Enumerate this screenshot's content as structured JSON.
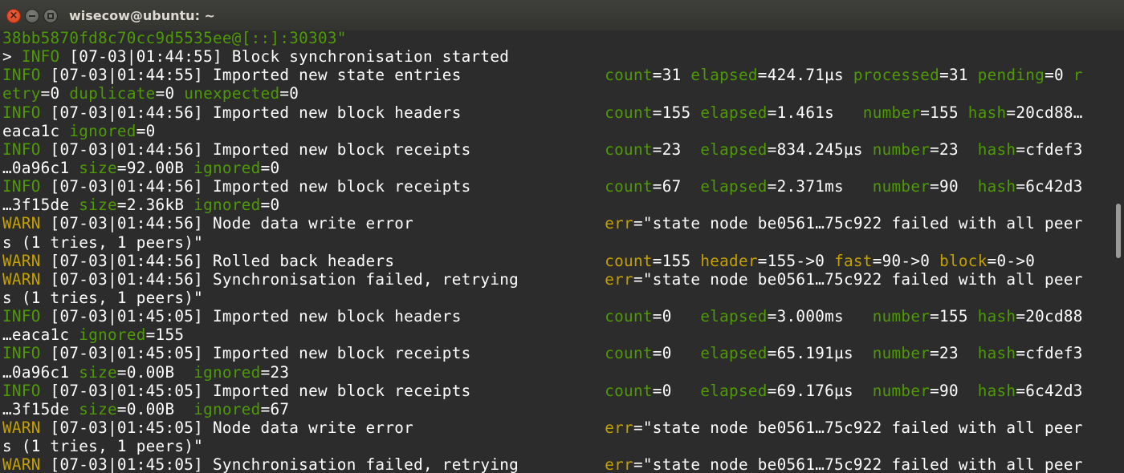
{
  "window": {
    "title": "wisecow@ubuntu: ~",
    "buttons": {
      "close": "×",
      "minimize": "",
      "maximize": ""
    }
  },
  "terminal": {
    "colors": {
      "background": "#2c2c2c",
      "text": "#ffffff",
      "info": "#4e9a06",
      "warn": "#c4a000"
    },
    "lines": [
      [
        {
          "t": "38bb5870fd8c70cc9d5535ee@[::]:30303\"",
          "c": "g"
        }
      ],
      [
        {
          "t": "> ",
          "c": "w"
        },
        {
          "t": "INFO",
          "c": "g"
        },
        {
          "t": " [07-03|01:44:55] Block synchronisation started",
          "c": "w"
        }
      ],
      [
        {
          "t": "INFO",
          "c": "g"
        },
        {
          "t": " [07-03|01:44:55] Imported new state entries               ",
          "c": "w"
        },
        {
          "t": "count",
          "c": "g"
        },
        {
          "t": "=31 ",
          "c": "w"
        },
        {
          "t": "elapsed",
          "c": "g"
        },
        {
          "t": "=424.71µs ",
          "c": "w"
        },
        {
          "t": "processed",
          "c": "g"
        },
        {
          "t": "=31 ",
          "c": "w"
        },
        {
          "t": "pending",
          "c": "g"
        },
        {
          "t": "=0 ",
          "c": "w"
        },
        {
          "t": "r",
          "c": "g"
        }
      ],
      [
        {
          "t": "etry",
          "c": "g"
        },
        {
          "t": "=0 ",
          "c": "w"
        },
        {
          "t": "duplicate",
          "c": "g"
        },
        {
          "t": "=0 ",
          "c": "w"
        },
        {
          "t": "unexpected",
          "c": "g"
        },
        {
          "t": "=0",
          "c": "w"
        }
      ],
      [
        {
          "t": "INFO",
          "c": "g"
        },
        {
          "t": " [07-03|01:44:56] Imported new block headers               ",
          "c": "w"
        },
        {
          "t": "count",
          "c": "g"
        },
        {
          "t": "=155 ",
          "c": "w"
        },
        {
          "t": "elapsed",
          "c": "g"
        },
        {
          "t": "=1.461s   ",
          "c": "w"
        },
        {
          "t": "number",
          "c": "g"
        },
        {
          "t": "=155 ",
          "c": "w"
        },
        {
          "t": "hash",
          "c": "g"
        },
        {
          "t": "=20cd88…",
          "c": "w"
        }
      ],
      [
        {
          "t": "eaca1c ",
          "c": "w"
        },
        {
          "t": "ignored",
          "c": "g"
        },
        {
          "t": "=0",
          "c": "w"
        }
      ],
      [
        {
          "t": "INFO",
          "c": "g"
        },
        {
          "t": " [07-03|01:44:56] Imported new block receipts              ",
          "c": "w"
        },
        {
          "t": "count",
          "c": "g"
        },
        {
          "t": "=23  ",
          "c": "w"
        },
        {
          "t": "elapsed",
          "c": "g"
        },
        {
          "t": "=834.245µs ",
          "c": "w"
        },
        {
          "t": "number",
          "c": "g"
        },
        {
          "t": "=23  ",
          "c": "w"
        },
        {
          "t": "hash",
          "c": "g"
        },
        {
          "t": "=cfdef3",
          "c": "w"
        }
      ],
      [
        {
          "t": "…0a96c1 ",
          "c": "w"
        },
        {
          "t": "size",
          "c": "g"
        },
        {
          "t": "=92.00B ",
          "c": "w"
        },
        {
          "t": "ignored",
          "c": "g"
        },
        {
          "t": "=0",
          "c": "w"
        }
      ],
      [
        {
          "t": "INFO",
          "c": "g"
        },
        {
          "t": " [07-03|01:44:56] Imported new block receipts              ",
          "c": "w"
        },
        {
          "t": "count",
          "c": "g"
        },
        {
          "t": "=67  ",
          "c": "w"
        },
        {
          "t": "elapsed",
          "c": "g"
        },
        {
          "t": "=2.371ms   ",
          "c": "w"
        },
        {
          "t": "number",
          "c": "g"
        },
        {
          "t": "=90  ",
          "c": "w"
        },
        {
          "t": "hash",
          "c": "g"
        },
        {
          "t": "=6c42d3",
          "c": "w"
        }
      ],
      [
        {
          "t": "…3f15de ",
          "c": "w"
        },
        {
          "t": "size",
          "c": "g"
        },
        {
          "t": "=2.36kB ",
          "c": "w"
        },
        {
          "t": "ignored",
          "c": "g"
        },
        {
          "t": "=0",
          "c": "w"
        }
      ],
      [
        {
          "t": "WARN",
          "c": "y"
        },
        {
          "t": " [07-03|01:44:56] Node data write error                    ",
          "c": "w"
        },
        {
          "t": "err",
          "c": "y"
        },
        {
          "t": "=\"state node be0561…75c922 failed with all peer",
          "c": "w"
        }
      ],
      [
        {
          "t": "s (1 tries, 1 peers)\"",
          "c": "w"
        }
      ],
      [
        {
          "t": "WARN",
          "c": "y"
        },
        {
          "t": " [07-03|01:44:56] Rolled back headers                      ",
          "c": "w"
        },
        {
          "t": "count",
          "c": "y"
        },
        {
          "t": "=155 ",
          "c": "w"
        },
        {
          "t": "header",
          "c": "y"
        },
        {
          "t": "=155->0 ",
          "c": "w"
        },
        {
          "t": "fast",
          "c": "y"
        },
        {
          "t": "=90->0 ",
          "c": "w"
        },
        {
          "t": "block",
          "c": "y"
        },
        {
          "t": "=0->0",
          "c": "w"
        }
      ],
      [
        {
          "t": "WARN",
          "c": "y"
        },
        {
          "t": " [07-03|01:44:56] Synchronisation failed, retrying         ",
          "c": "w"
        },
        {
          "t": "err",
          "c": "y"
        },
        {
          "t": "=\"state node be0561…75c922 failed with all peer",
          "c": "w"
        }
      ],
      [
        {
          "t": "s (1 tries, 1 peers)\"",
          "c": "w"
        }
      ],
      [
        {
          "t": "INFO",
          "c": "g"
        },
        {
          "t": " [07-03|01:45:05] Imported new block headers               ",
          "c": "w"
        },
        {
          "t": "count",
          "c": "g"
        },
        {
          "t": "=0   ",
          "c": "w"
        },
        {
          "t": "elapsed",
          "c": "g"
        },
        {
          "t": "=3.000ms   ",
          "c": "w"
        },
        {
          "t": "number",
          "c": "g"
        },
        {
          "t": "=155 ",
          "c": "w"
        },
        {
          "t": "hash",
          "c": "g"
        },
        {
          "t": "=20cd88",
          "c": "w"
        }
      ],
      [
        {
          "t": "…eaca1c ",
          "c": "w"
        },
        {
          "t": "ignored",
          "c": "g"
        },
        {
          "t": "=155",
          "c": "w"
        }
      ],
      [
        {
          "t": "INFO",
          "c": "g"
        },
        {
          "t": " [07-03|01:45:05] Imported new block receipts              ",
          "c": "w"
        },
        {
          "t": "count",
          "c": "g"
        },
        {
          "t": "=0   ",
          "c": "w"
        },
        {
          "t": "elapsed",
          "c": "g"
        },
        {
          "t": "=65.191µs  ",
          "c": "w"
        },
        {
          "t": "number",
          "c": "g"
        },
        {
          "t": "=23  ",
          "c": "w"
        },
        {
          "t": "hash",
          "c": "g"
        },
        {
          "t": "=cfdef3",
          "c": "w"
        }
      ],
      [
        {
          "t": "…0a96c1 ",
          "c": "w"
        },
        {
          "t": "size",
          "c": "g"
        },
        {
          "t": "=0.00B  ",
          "c": "w"
        },
        {
          "t": "ignored",
          "c": "g"
        },
        {
          "t": "=23",
          "c": "w"
        }
      ],
      [
        {
          "t": "INFO",
          "c": "g"
        },
        {
          "t": " [07-03|01:45:05] Imported new block receipts              ",
          "c": "w"
        },
        {
          "t": "count",
          "c": "g"
        },
        {
          "t": "=0   ",
          "c": "w"
        },
        {
          "t": "elapsed",
          "c": "g"
        },
        {
          "t": "=69.176µs  ",
          "c": "w"
        },
        {
          "t": "number",
          "c": "g"
        },
        {
          "t": "=90  ",
          "c": "w"
        },
        {
          "t": "hash",
          "c": "g"
        },
        {
          "t": "=6c42d3",
          "c": "w"
        }
      ],
      [
        {
          "t": "…3f15de ",
          "c": "w"
        },
        {
          "t": "size",
          "c": "g"
        },
        {
          "t": "=0.00B  ",
          "c": "w"
        },
        {
          "t": "ignored",
          "c": "g"
        },
        {
          "t": "=67",
          "c": "w"
        }
      ],
      [
        {
          "t": "WARN",
          "c": "y"
        },
        {
          "t": " [07-03|01:45:05] Node data write error                    ",
          "c": "w"
        },
        {
          "t": "err",
          "c": "y"
        },
        {
          "t": "=\"state node be0561…75c922 failed with all peer",
          "c": "w"
        }
      ],
      [
        {
          "t": "s (1 tries, 1 peers)\"",
          "c": "w"
        }
      ],
      [
        {
          "t": "WARN",
          "c": "y"
        },
        {
          "t": " [07-03|01:45:05] Synchronisation failed, retrying         ",
          "c": "w"
        },
        {
          "t": "err",
          "c": "y"
        },
        {
          "t": "=\"state node be0561…75c922 failed with all peer",
          "c": "w"
        }
      ]
    ]
  }
}
